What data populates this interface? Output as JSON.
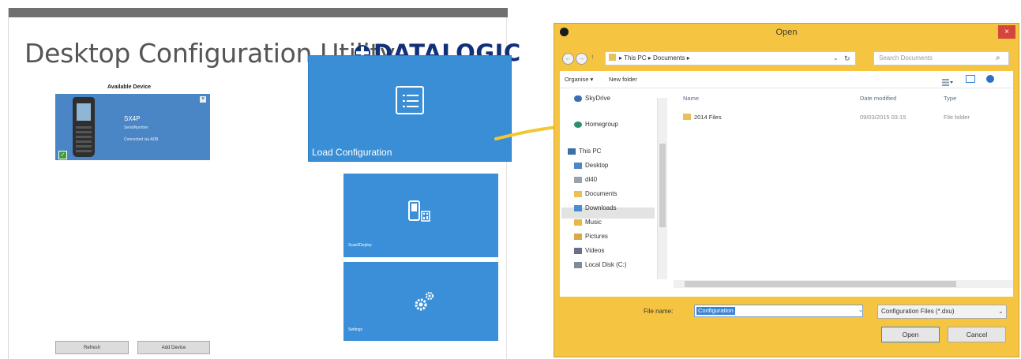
{
  "app": {
    "title": "Desktop Configuration Utility",
    "brand": "DATALOGIC",
    "available_device_label": "Available Device",
    "device": {
      "name": "SX4P",
      "serial": "SerialNumber",
      "connection": "Connected via ADB",
      "close_glyph": "×",
      "check_glyph": "✓"
    },
    "tiles": {
      "load": "Load Configuration",
      "scan": "Scan2Deploy",
      "settings": "Settings"
    },
    "buttons": {
      "refresh": "Refresh",
      "add_device": "Add Device"
    },
    "colors": {
      "tile_blue": "#3b8fd8",
      "brand_navy": "#11307a",
      "arrow_yellow": "#f3c632"
    }
  },
  "dialog": {
    "title": "Open",
    "close_glyph": "×",
    "back_glyph": "←",
    "forward_glyph": "→",
    "up_glyph": "↑",
    "breadcrumb": "▸ This PC ▸ Documents ▸",
    "refresh_glyph": "↻",
    "address_dropdown_glyph": "⌄",
    "search_placeholder": "Search Documents",
    "search_glyph": "⌕",
    "toolbar": {
      "organise": "Organise ▾",
      "new_folder": "New folder"
    },
    "nav": [
      {
        "label": "SkyDrive",
        "icon": "cloud-icon"
      },
      {
        "label": "Homegroup",
        "icon": "homegroup-icon"
      },
      {
        "label": "This PC",
        "icon": "computer-icon"
      },
      {
        "label": "Desktop",
        "icon": "desktop-icon"
      },
      {
        "label": "dl40",
        "icon": "user-icon"
      },
      {
        "label": "Documents",
        "icon": "documents-icon"
      },
      {
        "label": "Downloads",
        "icon": "downloads-icon"
      },
      {
        "label": "Music",
        "icon": "music-icon"
      },
      {
        "label": "Pictures",
        "icon": "pictures-icon"
      },
      {
        "label": "Videos",
        "icon": "videos-icon"
      },
      {
        "label": "Local Disk (C:)",
        "icon": "disk-icon"
      }
    ],
    "columns": {
      "name": "Name",
      "date": "Date modified",
      "type": "Type"
    },
    "files": [
      {
        "name": "2014 Files",
        "date": "09/03/2015 03:15",
        "type": "File folder"
      }
    ],
    "file_name_label": "File name:",
    "file_name_value": "Configuration",
    "filter": "Configuration Files (*.dxu)",
    "filter_glyph": "⌄",
    "open_button": "Open",
    "cancel_button": "Cancel"
  }
}
